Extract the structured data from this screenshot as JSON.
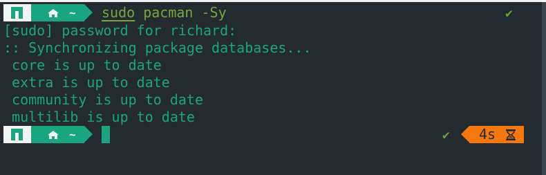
{
  "prompt": {
    "dir_label": "~"
  },
  "command": {
    "sudo": "sudo",
    "rest": " pacman -Sy"
  },
  "output": [
    "[sudo] password for richard:",
    ":: Synchronizing package databases...",
    " core is up to date",
    " extra is up to date",
    " community is up to date",
    " multilib is up to date"
  ],
  "status": {
    "success_mark": "✔",
    "duration": "4s"
  },
  "colors": {
    "background": "#232a30",
    "accent_green": "#1aa581",
    "command_green": "#76a83b",
    "timer_orange": "#f6780c"
  },
  "icons": [
    "manjaro-logo-icon",
    "home-icon",
    "check-icon",
    "hourglass-icon"
  ]
}
